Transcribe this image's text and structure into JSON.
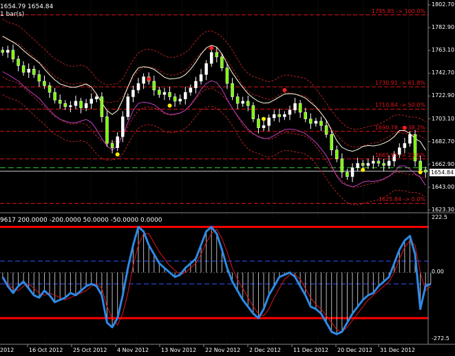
{
  "header": {
    "price_line": "1654.79 1654.84",
    "bars_line": "1 bar(s)"
  },
  "indicator": {
    "header_line": "9617 200.0000 -200.0000 50.0000 -50.0000 0.0000",
    "axis": [
      "222.5",
      "0.00",
      "-272.5"
    ]
  },
  "price_axis": [
    "1802.70",
    "1782.90",
    "1763.10",
    "1742.70",
    "1722.90",
    "1703.10",
    "1682.70",
    "1662.90",
    "1643.00",
    "1623.30"
  ],
  "current_price": "1654.84",
  "fib_levels": [
    {
      "label": "1795.85 -> 100.0%",
      "value": 1795.85
    },
    {
      "label": "1730.91 -> 61.8%",
      "value": 1730.91
    },
    {
      "label": "1710.84 -> 50.0%",
      "value": 1710.84
    },
    {
      "label": "1690.78 -> 38.2%",
      "value": 1690.78
    },
    {
      "label": "1665.95 -> 23.6%",
      "value": 1665.95
    },
    {
      "label": "1625.84 -> 0.0%",
      "value": 1625.84
    }
  ],
  "dates": [
    "16 Oct 2012",
    "25 Oct 2012",
    "4 Nov 2012",
    "13 Nov 2012",
    "22 Nov 2012",
    "2 Dec 2012",
    "11 Dec 2012",
    "20 Dec 2012",
    "31 Dec 2012"
  ],
  "colors": {
    "background": "#000000",
    "candle_up": "#ffffff",
    "candle_down": "#7cfc00",
    "fib": "#e0151b",
    "band_outer": "#b22222",
    "ma_upper": "#ffffe0",
    "ma_lower": "#c040c0",
    "cci_main": "#2e8ae6",
    "cci_signal": "#e0151b",
    "level": "#3355ff"
  },
  "chart_data": {
    "type": "candlestick",
    "price_range": [
      1618,
      1808
    ],
    "closes": [
      1762,
      1764,
      1756,
      1750,
      1744,
      1747,
      1742,
      1736,
      1732,
      1726,
      1719,
      1716,
      1713,
      1714,
      1718,
      1712,
      1716,
      1720,
      1722,
      1704,
      1680,
      1676,
      1686,
      1704,
      1722,
      1728,
      1734,
      1740,
      1736,
      1728,
      1724,
      1726,
      1722,
      1718,
      1720,
      1726,
      1730,
      1736,
      1742,
      1752,
      1762,
      1758,
      1748,
      1734,
      1722,
      1716,
      1718,
      1714,
      1702,
      1694,
      1696,
      1703,
      1706,
      1704,
      1706,
      1710,
      1716,
      1708,
      1702,
      1698,
      1700,
      1696,
      1688,
      1674,
      1666,
      1654,
      1650,
      1658,
      1662,
      1660,
      1662,
      1664,
      1662,
      1660,
      1664,
      1670,
      1676,
      1680,
      1688,
      1664,
      1656,
      1654
    ],
    "cci_range": [
      -272.5,
      222.5
    ],
    "cci": [
      -20,
      -60,
      -90,
      -60,
      -40,
      -70,
      -100,
      -110,
      -80,
      -100,
      -130,
      -120,
      -110,
      -90,
      -100,
      -80,
      -60,
      -50,
      -60,
      -100,
      -220,
      -240,
      -200,
      -100,
      20,
      120,
      200,
      180,
      120,
      80,
      40,
      20,
      0,
      -20,
      -10,
      20,
      40,
      60,
      120,
      180,
      200,
      170,
      100,
      20,
      -40,
      -80,
      -120,
      -150,
      -180,
      -200,
      -160,
      -100,
      -60,
      -20,
      -10,
      0,
      -20,
      -60,
      -100,
      -150,
      -160,
      -180,
      -220,
      -260,
      -270,
      -260,
      -220,
      -180,
      -150,
      -120,
      -100,
      -90,
      -60,
      -40,
      -20,
      40,
      100,
      140,
      160,
      80,
      -160,
      -60,
      -50
    ],
    "cci_signal": [
      -30,
      -50,
      -70,
      -80,
      -60,
      -50,
      -70,
      -90,
      -100,
      -90,
      -100,
      -110,
      -120,
      -110,
      -100,
      -90,
      -80,
      -60,
      -50,
      -70,
      -150,
      -200,
      -230,
      -180,
      -90,
      30,
      120,
      170,
      170,
      130,
      90,
      60,
      30,
      10,
      -10,
      0,
      20,
      40,
      80,
      130,
      170,
      190,
      150,
      90,
      20,
      -30,
      -70,
      -110,
      -150,
      -180,
      -190,
      -160,
      -110,
      -70,
      -30,
      -10,
      -10,
      -30,
      -70,
      -110,
      -140,
      -160,
      -190,
      -220,
      -250,
      -260,
      -240,
      -210,
      -180,
      -150,
      -120,
      -100,
      -80,
      -60,
      -40,
      0,
      60,
      110,
      140,
      120,
      0,
      -80,
      -60
    ],
    "levels": [
      200,
      50,
      -50,
      -200,
      0
    ]
  }
}
